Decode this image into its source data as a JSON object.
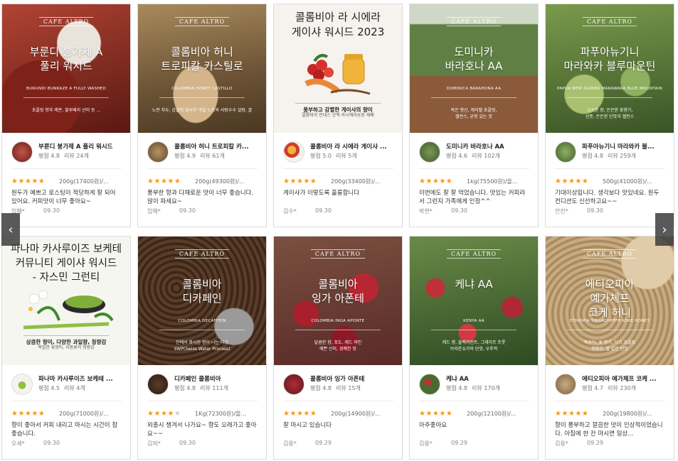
{
  "brand": "CAFE ALTRO",
  "nav": {
    "prev": "‹",
    "next": "›"
  },
  "cards": [
    {
      "image_title": "부룬디 붕가제 A\n풀리 워시드",
      "image_en": "BURUNDI BUNKAZE A FULLY WASHED",
      "image_desc": "초콜릿 향과 레몬, 블루베리 산미 등 ...",
      "image_tag": "",
      "name": "부룬디 붕가제 A 풀리 워시드",
      "rating_label": "평점",
      "rating": "4.8",
      "reviews_label": "리뷰",
      "reviews": "24개",
      "stars": 5,
      "option": "200g(17400원)/...",
      "review": "원두가 예쁘고 로스팅이 적당하게 잘 되어 있어요. 커피맛이 너무 좋아요~",
      "author": "임해*",
      "date": "09.30",
      "theme": "#9c3a2c"
    },
    {
      "image_title": "콜롬비아 허니\n트로피칼 카스틸로",
      "image_en": "COLOMBIA HONEY CASTILLO",
      "image_desc": "노란 자두, 감귤의 화사한 과일 노트와 사탕수수 설탕, 꿀",
      "image_tag": "",
      "name": "콜롬비아 허니 트로피칼 카...",
      "rating_label": "평점",
      "rating": "4.9",
      "reviews_label": "리뷰",
      "reviews": "61개",
      "stars": 5,
      "option": "200g(49300원)/...",
      "review": "풍부한 향과 다채로운 맛이 너무 좋습니다. 많이 파세요~",
      "author": "임해*",
      "date": "09.30",
      "theme": "#9a7f55"
    },
    {
      "image_title": "콜롬비아 라 시에라\n게이샤 워시드 2023",
      "image_en": "",
      "image_desc": "콜롬비아 안데스 산맥 라시에라농장 재배",
      "image_tag": "풍부하고 강렬한 게이샤의 향미",
      "name": "콜롬비아 라 시에라 게이샤 ...",
      "rating_label": "평점",
      "rating": "5.0",
      "reviews_label": "리뷰",
      "reviews": "5개",
      "stars": 5,
      "option": "200g(33400원)/...",
      "review": "게이샤가 이렇도록 훌륭합니다",
      "author": "김수*",
      "date": "09.30",
      "theme": "#f6f2ee"
    },
    {
      "image_title": "도미니카\n바라호나 AA",
      "image_en": "DOMINICA BARAHONA AA",
      "image_desc": "묵은 향신, 캐러멜 초콜릿,\n밸런스, 균형 있는 맛",
      "image_tag": "",
      "name": "도미니카 바라호나 AA",
      "rating_label": "평점",
      "rating": "4.6",
      "reviews_label": "리뷰",
      "reviews": "102개",
      "stars": 5,
      "option": "1kg(75500원)/을...",
      "review": "이번에도 잘 잘 먹었습니다. 맛있는 커피라서 그런지 가족에게 인정^^",
      "author": "박현*",
      "date": "09.30",
      "theme": "#4d6a3a"
    },
    {
      "image_title": "파푸아뉴기니\n마라와카 블루마운틴",
      "image_en": "PAPUA NEW GUINEA MARAWAKA BLUE MOUNTAIN",
      "image_desc": "고소한 향, 은은한 꽃향기,\n산뜻, 은은한 단맛과 밸런스",
      "image_tag": "",
      "name": "파푸아뉴기니 마라와카 블...",
      "rating_label": "평점",
      "rating": "4.8",
      "reviews_label": "리뷰",
      "reviews": "259개",
      "stars": 5,
      "option": "500g(41000원)/...",
      "review": "기대이상입니다. 생각보다 맛있네요. 원두 컨디션도 신선하고요~~",
      "author": "안진*",
      "date": "09.30",
      "theme": "#5c7a3c"
    },
    {
      "image_title": "파나마 카사루이즈 보케테\n커뮤니티 게이샤 워시드\n- 자스민 그런티",
      "image_en": "",
      "image_desc": "복잡한 꽃향미, 자몽류의 청량감",
      "image_tag": "상큼한 향미, 다양한 과일향, 청량감",
      "name": "파나마 카사루이즈 보케테 ...",
      "rating_label": "평점",
      "rating": "4.5",
      "reviews_label": "리뷰",
      "reviews": "4개",
      "stars": 5,
      "option": "200g(71000원)/...",
      "review": "향이 좋아서 커피 내리고 마시는 시간이 참 좋습니다.",
      "author": "오세*",
      "date": "09.30",
      "theme": "#f4f4ec"
    },
    {
      "image_title": "콜롬비아\n디카페인",
      "image_en": "COLOMBIA DECAFFEIN",
      "image_desc": "잔에서 화사한 향이 나는 다크\nSWP(Swiss Water Process)",
      "image_tag": "",
      "name": "디카페인 콜롬비아",
      "rating_label": "평점",
      "rating": "4.8",
      "reviews_label": "리뷰",
      "reviews": "111개",
      "stars": 4,
      "option": "1Kg(72300원)/을...",
      "review": "외출시 챙겨서 나가요~ 향도 오래가고 좋아요~~",
      "author": "김외*",
      "date": "09.30",
      "theme": "#4a3426"
    },
    {
      "image_title": "콜롬비아\n잉가 아폰테",
      "image_en": "COLOMBIA INGA APONTE",
      "image_desc": "달콤한 향, 포도, 레드 와인\n예쁜 산미, 경쾌한 맛",
      "image_tag": "",
      "name": "콜롬비아 잉가 아폰테",
      "rating_label": "평점",
      "rating": "4.8",
      "reviews_label": "리뷰",
      "reviews": "15개",
      "stars": 5,
      "option": "200g(14900원)/...",
      "review": "잘 마시고 있습니다",
      "author": "김용*",
      "date": "09.29",
      "theme": "#8a2430"
    },
    {
      "image_title": "케냐 AA",
      "image_en": "KENYA AA",
      "image_desc": "레드 향, 블랙커런트, 그레이프 프룻\n브라운슈가의 단맛, 우주적",
      "image_tag": "",
      "name": "케냐 AA",
      "rating_label": "평점",
      "rating": "4.8",
      "reviews_label": "리뷰",
      "reviews": "170개",
      "stars": 5,
      "option": "200g(12100원)/...",
      "review": "아주좋아요",
      "author": "김용*",
      "date": "09.29",
      "theme": "#3e5c2a"
    },
    {
      "image_title": "에티오피아\n예가체프\n코케 허니",
      "image_en": "ETHIOPIA YIRGACHEFFE KOKE HONEY",
      "image_desc": "복숭아, 꽃 향기, 다크 초콜릿\n청량감, 꿀 같은 단맛",
      "image_tag": "",
      "name": "에티오피아 예가체프 코케 ...",
      "rating_label": "평점",
      "rating": "4.7",
      "reviews_label": "리뷰",
      "reviews": "230개",
      "stars": 5,
      "option": "200g(19800원)/...",
      "review": "향이 풍부하고 깔끔한 맛이 인상적이었습니다. 아침에 한 잔 마시면 일상...",
      "author": "김용*",
      "date": "09.29",
      "theme": "#b89b72"
    }
  ]
}
